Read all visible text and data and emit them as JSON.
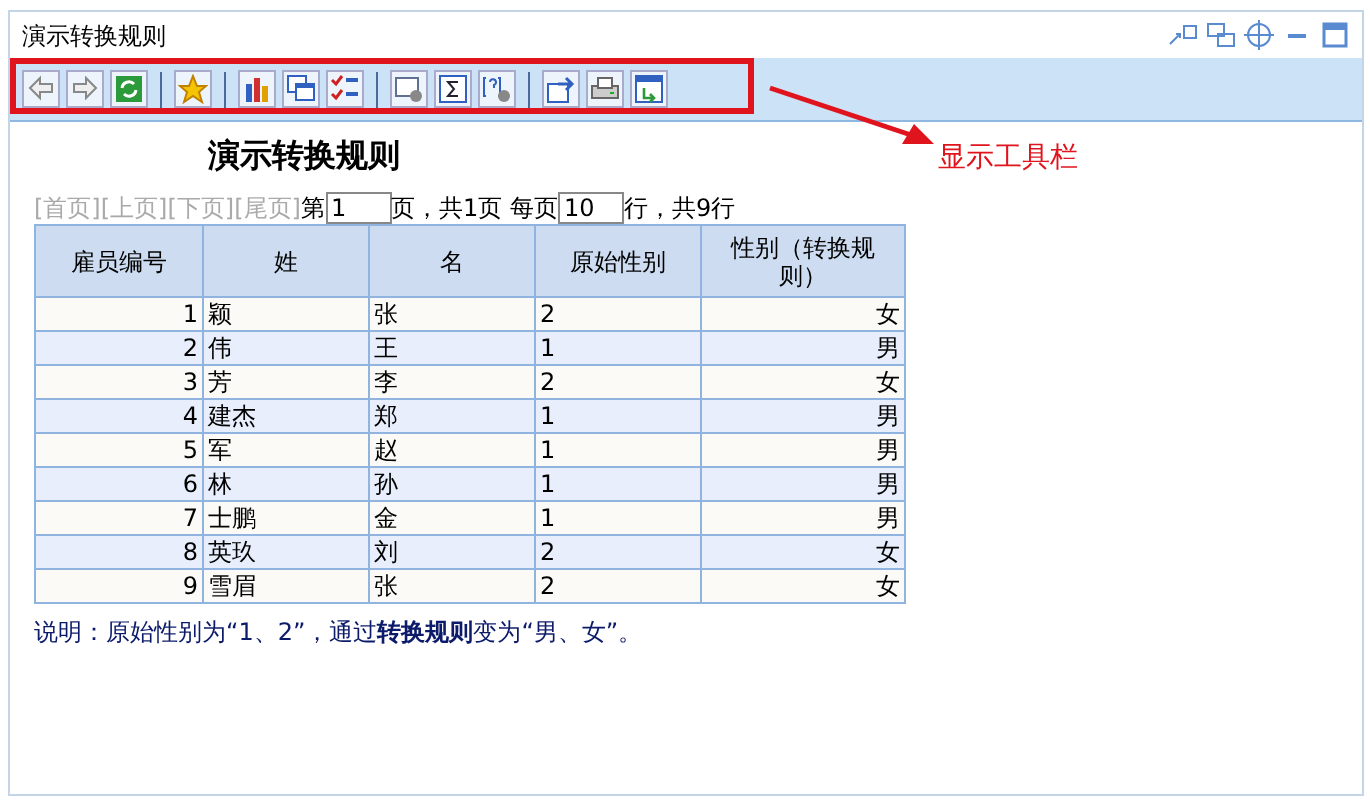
{
  "window": {
    "title": "演示转换规则"
  },
  "annotation": {
    "label": "显示工具栏"
  },
  "report": {
    "title": "演示转换规则",
    "pager": {
      "links": [
        "[首页]",
        "[上页]",
        "[下页]",
        "[尾页]"
      ],
      "prefix": "第",
      "page": "1",
      "middle": "页，共1页 每页",
      "page_size": "10",
      "suffix": "行，共9行"
    },
    "columns": [
      "雇员编号",
      "姓",
      "名",
      "原始性别",
      "性别（转换规则）"
    ],
    "rows": [
      [
        "1",
        "颖",
        "张",
        "2",
        "女"
      ],
      [
        "2",
        "伟",
        "王",
        "1",
        "男"
      ],
      [
        "3",
        "芳",
        "李",
        "2",
        "女"
      ],
      [
        "4",
        "建杰",
        "郑",
        "1",
        "男"
      ],
      [
        "5",
        "军",
        "赵",
        "1",
        "男"
      ],
      [
        "6",
        "林",
        "孙",
        "1",
        "男"
      ],
      [
        "7",
        "士鹏",
        "金",
        "1",
        "男"
      ],
      [
        "8",
        "英玖",
        "刘",
        "2",
        "女"
      ],
      [
        "9",
        "雪眉",
        "张",
        "2",
        "女"
      ]
    ],
    "note": "说明：原始性别为“1、2”，通过**转换规则**变为“男、女”。"
  }
}
